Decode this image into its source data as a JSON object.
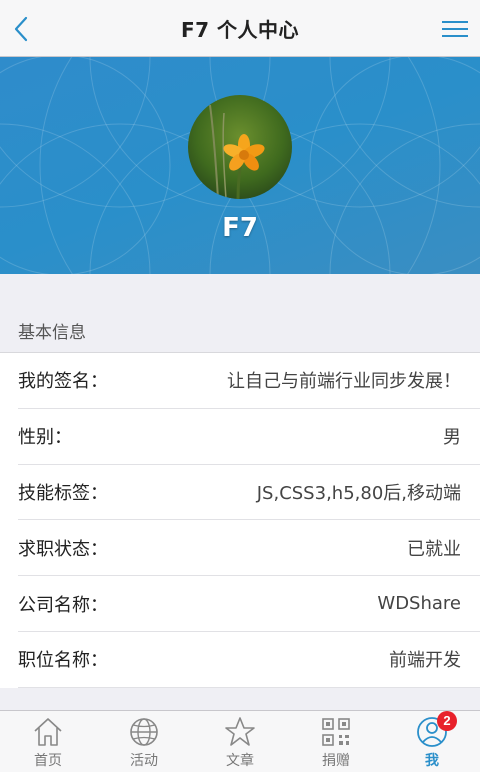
{
  "navbar": {
    "title": "F7 个人中心",
    "back_icon": "chevron-left-icon",
    "menu_icon": "hamburger-menu-icon",
    "accent_color": "#2a8fca"
  },
  "profile": {
    "name": "F7",
    "avatar_icon": "flower-photo-avatar",
    "banner_color": "#2f8ccb"
  },
  "section": {
    "title": "基本信息"
  },
  "info": [
    {
      "label": "我的签名：",
      "value": "让自己与前端行业同步发展！"
    },
    {
      "label": "性别：",
      "value": "男"
    },
    {
      "label": "技能标签：",
      "value": "JS,CSS3,h5,80后,移动端"
    },
    {
      "label": "求职状态：",
      "value": "已就业"
    },
    {
      "label": "公司名称：",
      "value": "WDShare"
    },
    {
      "label": "职位名称：",
      "value": "前端开发"
    }
  ],
  "tabbar": {
    "tabs": [
      {
        "label": "首页",
        "icon": "home-icon"
      },
      {
        "label": "活动",
        "icon": "globe-icon"
      },
      {
        "label": "文章",
        "icon": "star-icon"
      },
      {
        "label": "捐赠",
        "icon": "qr-code-icon"
      },
      {
        "label": "我",
        "icon": "user-icon",
        "badge": "2",
        "active": true
      }
    ],
    "active_color": "#2a8fca",
    "badge_color": "#e8212b"
  }
}
